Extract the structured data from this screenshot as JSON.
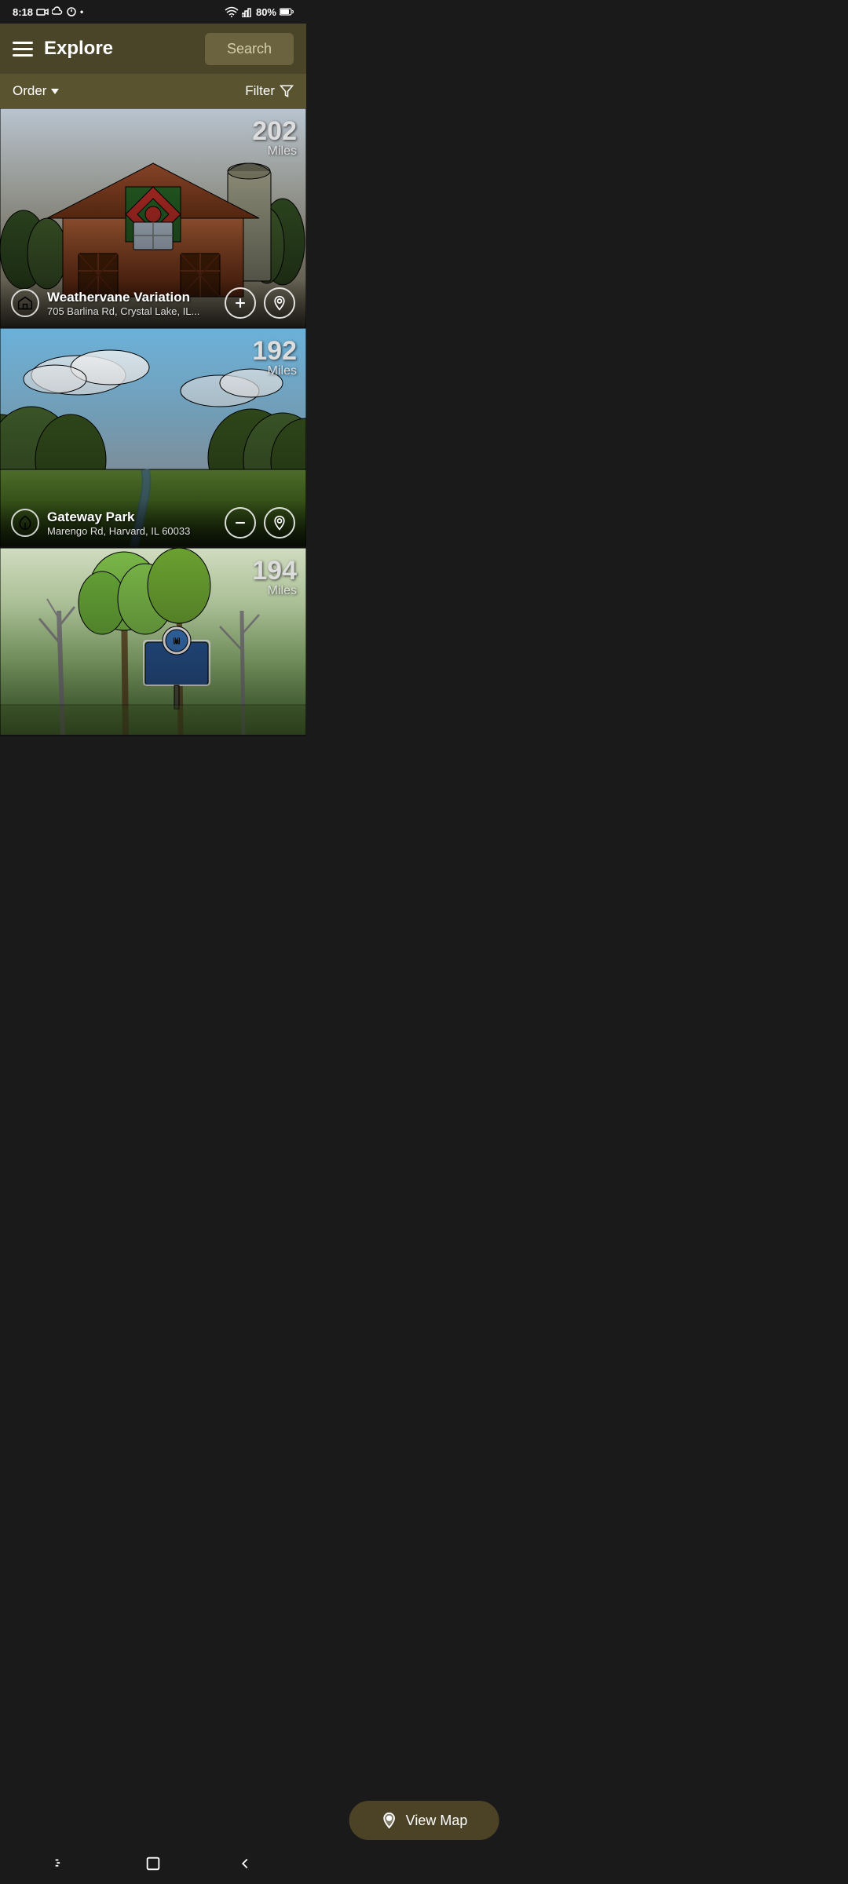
{
  "statusBar": {
    "time": "8:18",
    "battery": "80%"
  },
  "header": {
    "title": "Explore",
    "menuIcon": "hamburger-icon",
    "searchLabel": "Search"
  },
  "toolbar": {
    "orderLabel": "Order",
    "filterLabel": "Filter"
  },
  "cards": [
    {
      "id": "card-1",
      "distance": "202",
      "distanceUnit": "Miles",
      "title": "Weathervane Variation",
      "address": "705 Barlina Rd, Crystal Lake, IL...",
      "iconType": "barn",
      "action": "add"
    },
    {
      "id": "card-2",
      "distance": "192",
      "distanceUnit": "Miles",
      "title": "Gateway Park",
      "address": "Marengo Rd, Harvard, IL 60033",
      "iconType": "leaf",
      "action": "minus"
    },
    {
      "id": "card-3",
      "distance": "194",
      "distanceUnit": "Miles",
      "title": "",
      "address": "",
      "iconType": "",
      "action": ""
    }
  ],
  "viewMap": {
    "label": "View Map"
  },
  "bottomNav": {
    "backIcon": "back",
    "homeIcon": "home",
    "menuIcon": "menu"
  }
}
